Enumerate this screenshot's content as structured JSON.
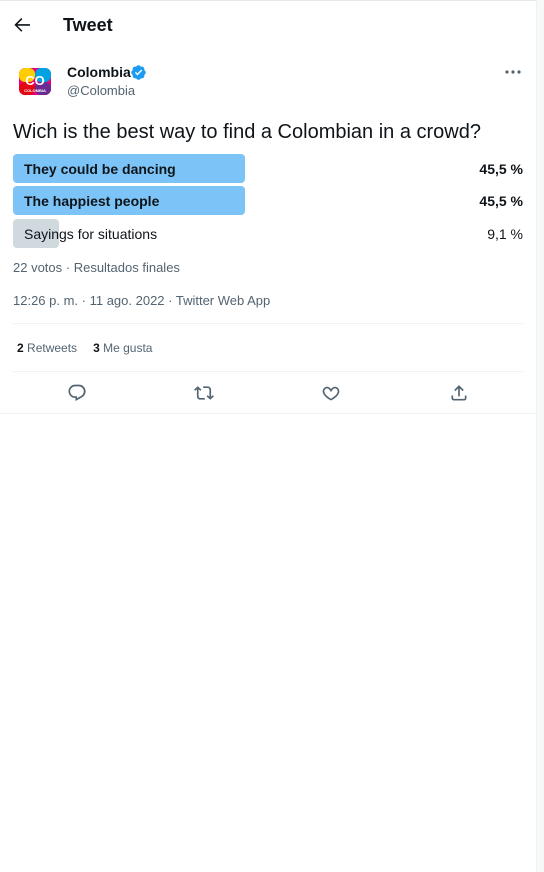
{
  "header": {
    "title": "Tweet"
  },
  "author": {
    "name": "Colombia",
    "handle": "@Colombia",
    "avatar_text": "CO",
    "avatar_sub": "COLOMBIA"
  },
  "tweet": {
    "text": "Wich is the best way to find a Colombian in a crowd?"
  },
  "poll": {
    "options": [
      {
        "label": "They could be dancing",
        "percent": "45,5 %",
        "share": 0.455,
        "winner": true
      },
      {
        "label": "The happiest people",
        "percent": "45,5 %",
        "share": 0.455,
        "winner": true
      },
      {
        "label": "Sayings for situations",
        "percent": "9,1 %",
        "share": 0.091,
        "winner": false
      }
    ],
    "summary": "22 votos · Resultados finales"
  },
  "meta": {
    "timestamp": "12:26 p. m. · 11 ago. 2022 · Twitter Web App"
  },
  "stats": {
    "retweets_count": "2",
    "retweets_label": "Retweets",
    "likes_count": "3",
    "likes_label": "Me gusta"
  },
  "colors": {
    "accent": "#1d9bf0",
    "poll_winner": "#7cc4f7",
    "poll_other": "#cfd9de",
    "muted": "#536471"
  }
}
